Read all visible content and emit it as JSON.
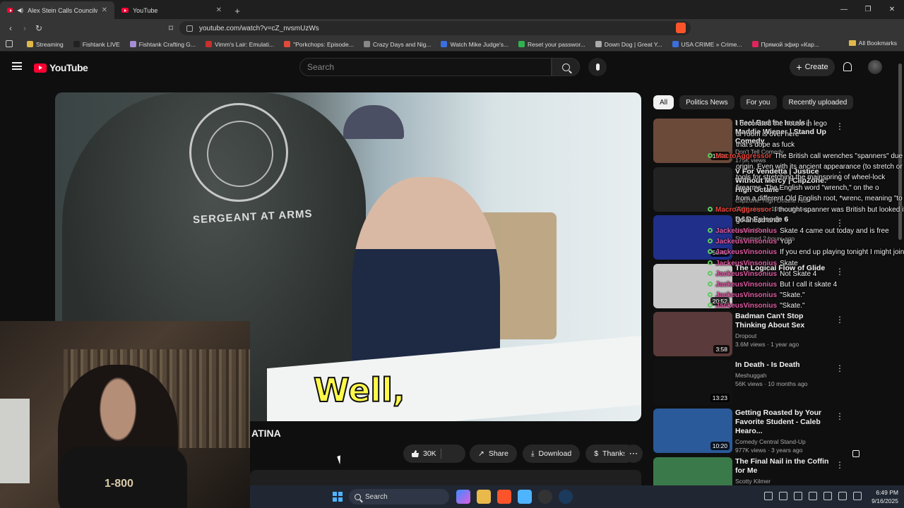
{
  "browser": {
    "tabs": [
      {
        "title": "Alex Stein Calls Councilwoma"
      },
      {
        "title": "YouTube"
      }
    ],
    "new_tab": "+",
    "url": "youtube.com/watch?v=cZ_nvsmUzWs",
    "bookmarks": [
      {
        "label": "Streaming",
        "color": "#e0b84a"
      },
      {
        "label": "Fishtank LIVE",
        "color": "#222"
      },
      {
        "label": "Fishtank Crafting G...",
        "color": "#a58ed6"
      },
      {
        "label": "Vimm's Lair: Emulati...",
        "color": "#c9302c"
      },
      {
        "label": "\"Porkchops: Episode...",
        "color": "#e04a3a"
      },
      {
        "label": "Crazy Days and Nig...",
        "color": "#888"
      },
      {
        "label": "Watch Mike Judge's...",
        "color": "#3b6fe0"
      },
      {
        "label": "Reset your passwor...",
        "color": "#2fb350"
      },
      {
        "label": "Down Dog | Great Y...",
        "color": "#aaa"
      },
      {
        "label": "USA CRIME » Crime...",
        "color": "#3b6fe0"
      },
      {
        "label": "Прямой эфир «Кар...",
        "color": "#e0245e"
      }
    ],
    "all_bookmarks": "All Bookmarks"
  },
  "youtube": {
    "logo_text": "YouTube",
    "search_placeholder": "Search",
    "create_label": "Create",
    "video": {
      "caption": "Well,",
      "title_fragment": "ATINA",
      "seal_text": "SERGEANT AT ARMS",
      "like_count": "30K",
      "share_label": "Share",
      "download_label": "Download",
      "thanks_label": "Thanks",
      "more": "⋯"
    },
    "chips": [
      "All",
      "Politics News",
      "For you",
      "Recently uploaded"
    ],
    "recommendations": [
      {
        "title": "I Feel Bad for Incels | Maddie Wiener | Stand Up Comedy",
        "channel": "Don't Tell Comedy",
        "meta": "175K views",
        "duration": "10:06"
      },
      {
        "title": "V For Vendetta | Justice Without Mercy | ClipZone: High Octane",
        "channel": "ClipZone: High Octane Hits",
        "meta": "992K views · 10 months ago",
        "duration": ""
      },
      {
        "title": "D&D Episode 6",
        "channel": "Nomad Push",
        "meta": "Streamed 2 hours ago",
        "duration": "58:45"
      },
      {
        "title": "The Logical Flow of Glide",
        "channel": "",
        "meta": "",
        "duration": "20:52"
      },
      {
        "title": "Badman Can't Stop Thinking About Sex",
        "channel": "Dropout",
        "meta": "3.6M views · 1 year ago",
        "duration": "3:58"
      },
      {
        "title": "In Death - Is Death",
        "channel": "Meshuggah",
        "meta": "56K views · 10 months ago",
        "duration": "13:23"
      },
      {
        "title": "Getting Roasted by Your Favorite Student - Caleb Hearo...",
        "channel": "Comedy Central Stand-Up",
        "meta": "977K views · 3 years ago",
        "duration": "10:20"
      },
      {
        "title": "The Final Nail in the Coffin for Me",
        "channel": "Scotty Kilmer",
        "meta": "",
        "duration": ""
      }
    ]
  },
  "chat": [
    {
      "user": "",
      "text": "I decorated the house in lego",
      "color": "#fff"
    },
    {
      "user": "",
      "text": "ur room is over here",
      "color": "#fff"
    },
    {
      "user": "",
      "text": "that's dope as fuck",
      "color": "#fff"
    },
    {
      "user": "MacroAggressor",
      "text": "The British call wrenches \"spanners\" due to",
      "color": "#e8453c"
    },
    {
      "user": "",
      "text": "origin. Even with its ancient appearance (to stretch or pull) and",
      "color": "#fff"
    },
    {
      "user": "",
      "text": "tools for stretching the mainspring of wheel-lock",
      "color": "#fff"
    },
    {
      "user": "",
      "text": "firearms. The English word \"wrench,\" on the o",
      "color": "#fff"
    },
    {
      "user": "",
      "text": "from a different Old English root, *wrenc, meaning \"to twist\".",
      "color": "#fff"
    },
    {
      "user": "MacroAggressor",
      "text": "I thought spanner was British but looked it up",
      "color": "#e8453c"
    },
    {
      "user": "",
      "text": "go ahead and",
      "color": "#fff"
    },
    {
      "user": "JackeusVinsonius",
      "text": "Skate 4 came out today and is free",
      "color": "#e05ca3"
    },
    {
      "user": "JackeusVinsonius",
      "text": "Yup",
      "color": "#e05ca3"
    },
    {
      "user": "JackeusVinsonius",
      "text": "If you end up playing tonight I might join",
      "color": "#e05ca3"
    },
    {
      "user": "JackeusVinsonius",
      "text": "Skate",
      "color": "#e05ca3"
    },
    {
      "user": "JackeusVinsonius",
      "text": "Not Skate 4",
      "color": "#e05ca3"
    },
    {
      "user": "JackeusVinsonius",
      "text": "But I call it skate 4",
      "color": "#e05ca3"
    },
    {
      "user": "JackeusVinsonius",
      "text": "\"Skate.\"",
      "color": "#e05ca3"
    },
    {
      "user": "JackeusVinsonius",
      "text": "\"Skate.\"",
      "color": "#e05ca3"
    }
  ],
  "taskbar": {
    "search": "Search",
    "time": "6:49 PM",
    "date": "9/16/2025"
  },
  "webcam": {
    "shirt_text": "1-800"
  }
}
